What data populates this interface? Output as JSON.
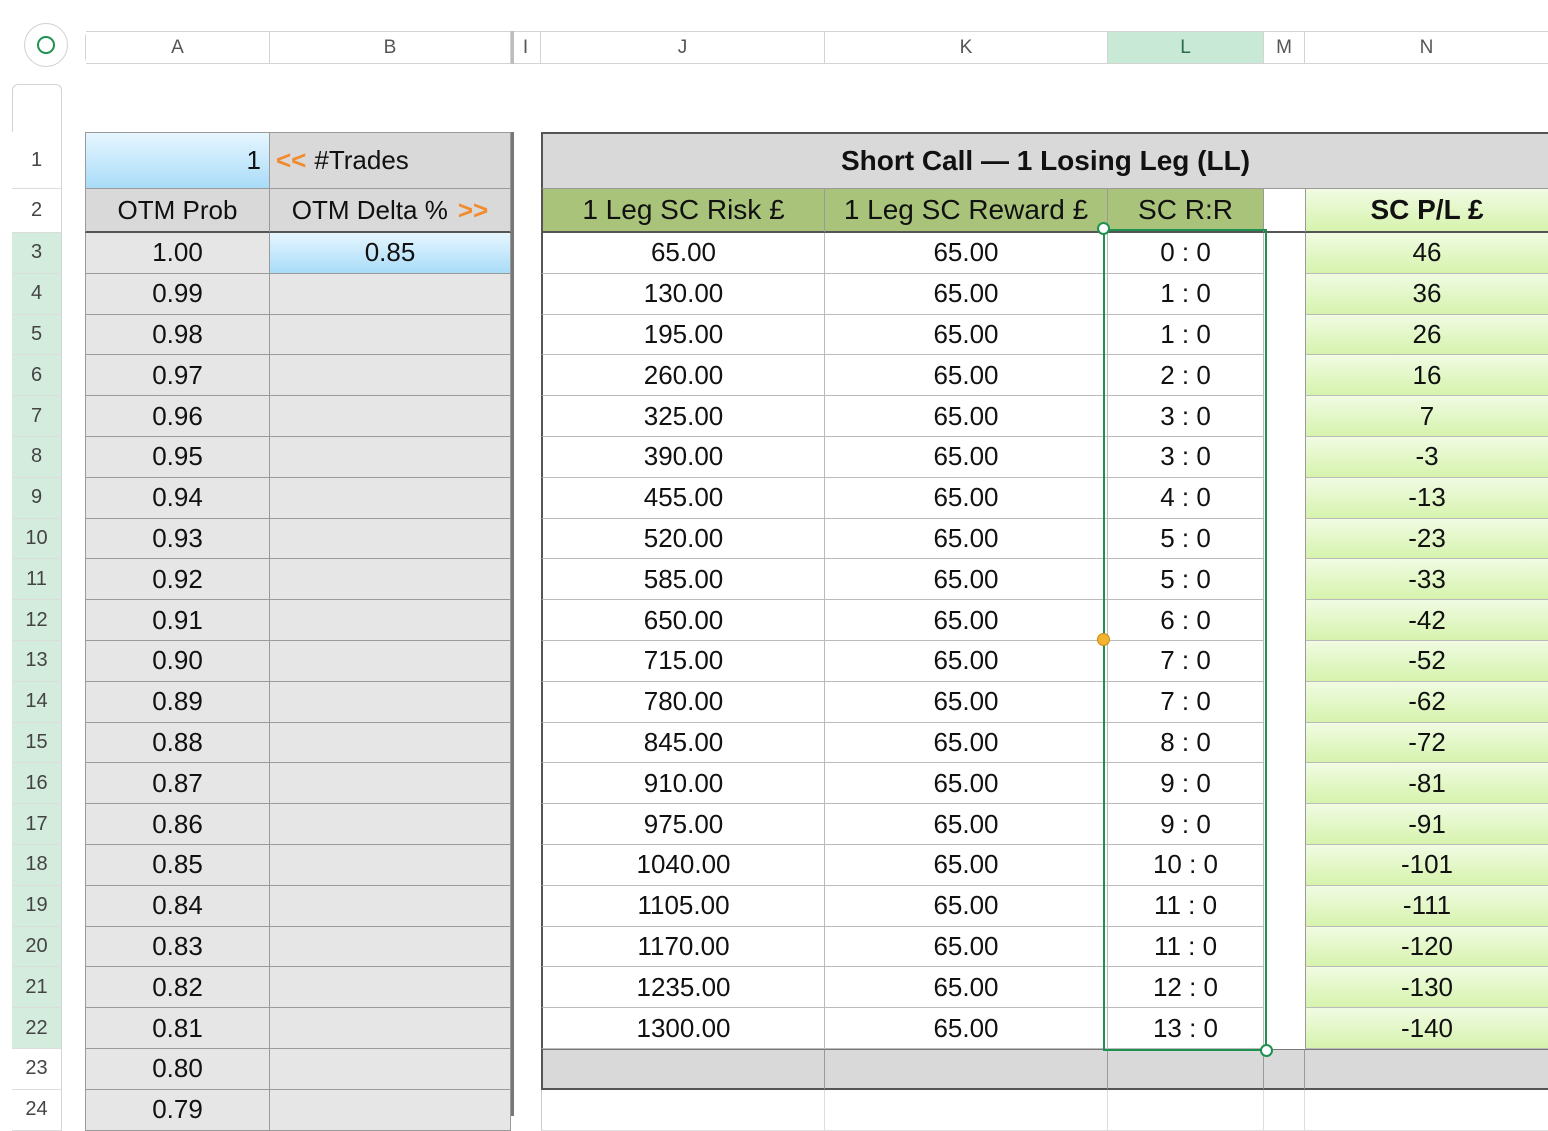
{
  "columns": [
    "A",
    "B",
    "I",
    "J",
    "K",
    "L",
    "M",
    "N"
  ],
  "rows": [
    "1",
    "2",
    "3",
    "4",
    "5",
    "6",
    "7",
    "8",
    "9",
    "10",
    "11",
    "12",
    "13",
    "14",
    "15",
    "16",
    "17",
    "18",
    "19",
    "20",
    "21",
    "22",
    "23",
    "24"
  ],
  "trades_value": "1",
  "trades_arrow": "<<",
  "trades_label": "#Trades",
  "otm_prob_header": "OTM Prob",
  "otm_delta_header": "OTM Delta %",
  "delta_arrow": ">>",
  "delta_value": "0.85",
  "title": "Short Call — 1 Losing Leg (LL)",
  "headers": {
    "risk": "1 Leg SC Risk £",
    "reward": "1 Leg SC Reward £",
    "rr": "SC R:R",
    "pl": "SC P/L £"
  },
  "otm_prob": [
    "1.00",
    "0.99",
    "0.98",
    "0.97",
    "0.96",
    "0.95",
    "0.94",
    "0.93",
    "0.92",
    "0.91",
    "0.90",
    "0.89",
    "0.88",
    "0.87",
    "0.86",
    "0.85",
    "0.84",
    "0.83",
    "0.82",
    "0.81",
    "0.80",
    "0.79"
  ],
  "risk": [
    "65.00",
    "130.00",
    "195.00",
    "260.00",
    "325.00",
    "390.00",
    "455.00",
    "520.00",
    "585.00",
    "650.00",
    "715.00",
    "780.00",
    "845.00",
    "910.00",
    "975.00",
    "1040.00",
    "1105.00",
    "1170.00",
    "1235.00",
    "1300.00"
  ],
  "reward": [
    "65.00",
    "65.00",
    "65.00",
    "65.00",
    "65.00",
    "65.00",
    "65.00",
    "65.00",
    "65.00",
    "65.00",
    "65.00",
    "65.00",
    "65.00",
    "65.00",
    "65.00",
    "65.00",
    "65.00",
    "65.00",
    "65.00",
    "65.00"
  ],
  "rr": [
    "0 : 0",
    "1 : 0",
    "1 : 0",
    "2 : 0",
    "3 : 0",
    "3 : 0",
    "4 : 0",
    "5 : 0",
    "5 : 0",
    "6 : 0",
    "7 : 0",
    "7 : 0",
    "8 : 0",
    "9 : 0",
    "9 : 0",
    "10 : 0",
    "11 : 0",
    "11 : 0",
    "12 : 0",
    "13 : 0"
  ],
  "pl": [
    "46",
    "36",
    "26",
    "16",
    "7",
    "-3",
    "-13",
    "-23",
    "-33",
    "-42",
    "-52",
    "-62",
    "-72",
    "-81",
    "-91",
    "-101",
    "-111",
    "-120",
    "-130",
    "-140"
  ],
  "colors": {
    "selection": "#1e9150",
    "accent_orange": "#f28a2e",
    "header_green": "#a9c47a",
    "header_grey": "#d9d9d9"
  }
}
